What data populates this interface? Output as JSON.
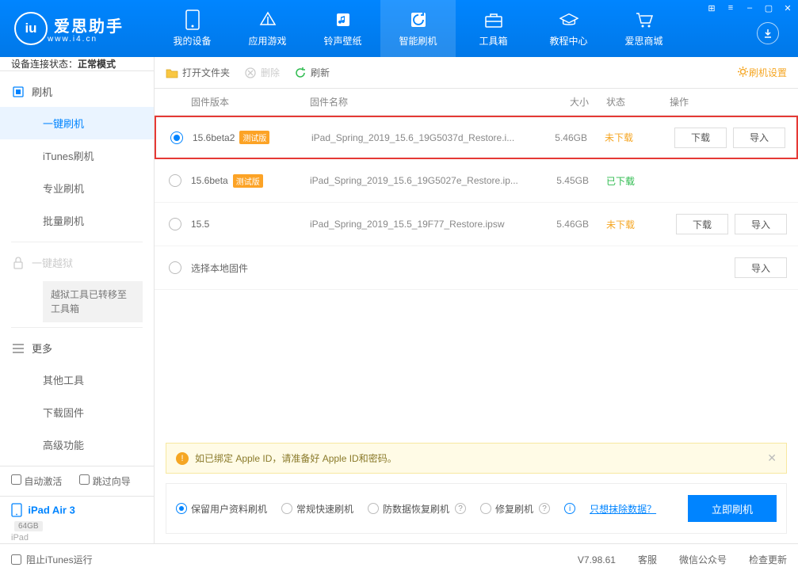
{
  "app": {
    "name": "爱思助手",
    "url": "www.i4.cn",
    "logo_letter": "i"
  },
  "win": {
    "grid": "⊞",
    "list": "≡",
    "min": "–",
    "max": "▢",
    "close": "✕"
  },
  "nav": {
    "items": [
      {
        "label": "我的设备"
      },
      {
        "label": "应用游戏"
      },
      {
        "label": "铃声壁纸"
      },
      {
        "label": "智能刷机"
      },
      {
        "label": "工具箱"
      },
      {
        "label": "教程中心"
      },
      {
        "label": "爱思商城"
      }
    ]
  },
  "status": {
    "label": "设备连接状态：",
    "value": "正常模式"
  },
  "sidebar": {
    "flash": {
      "head": "刷机",
      "items": [
        "一键刷机",
        "iTunes刷机",
        "专业刷机",
        "批量刷机"
      ]
    },
    "jailbreak": {
      "head": "一键越狱",
      "note": "越狱工具已转移至工具箱"
    },
    "more": {
      "head": "更多",
      "items": [
        "其他工具",
        "下载固件",
        "高级功能"
      ]
    },
    "checks": {
      "auto": "自动激活",
      "skip": "跳过向导"
    },
    "device": {
      "name": "iPad Air 3",
      "badge": "64GB",
      "sub": "iPad"
    }
  },
  "toolbar": {
    "open": "打开文件夹",
    "delete": "删除",
    "refresh": "刷新",
    "settings": "刷机设置"
  },
  "table": {
    "headers": {
      "version": "固件版本",
      "name": "固件名称",
      "size": "大小",
      "status": "状态",
      "ops": "操作"
    },
    "ops": {
      "download": "下载",
      "import": "导入"
    },
    "rows": [
      {
        "version": "15.6beta2",
        "beta": "测试版",
        "name": "iPad_Spring_2019_15.6_19G5037d_Restore.i...",
        "size": "5.46GB",
        "status": "未下载",
        "status_class": "st-not",
        "selected": true,
        "show_ops": true
      },
      {
        "version": "15.6beta",
        "beta": "测试版",
        "name": "iPad_Spring_2019_15.6_19G5027e_Restore.ip...",
        "size": "5.45GB",
        "status": "已下载",
        "status_class": "st-done",
        "selected": false,
        "show_ops": false
      },
      {
        "version": "15.5",
        "beta": "",
        "name": "iPad_Spring_2019_15.5_19F77_Restore.ipsw",
        "size": "5.46GB",
        "status": "未下载",
        "status_class": "st-not",
        "selected": false,
        "show_ops": true
      }
    ],
    "local_row": "选择本地固件"
  },
  "notice": {
    "text": "如已绑定 Apple ID，请准备好 Apple ID和密码。"
  },
  "flash_opts": {
    "items": [
      "保留用户资料刷机",
      "常规快速刷机",
      "防数据恢复刷机",
      "修复刷机"
    ],
    "link": "只想抹除数据？",
    "button": "立即刷机"
  },
  "footer": {
    "block_itunes": "阻止iTunes运行",
    "version": "V7.98.61",
    "service": "客服",
    "wechat": "微信公众号",
    "update": "检查更新"
  }
}
